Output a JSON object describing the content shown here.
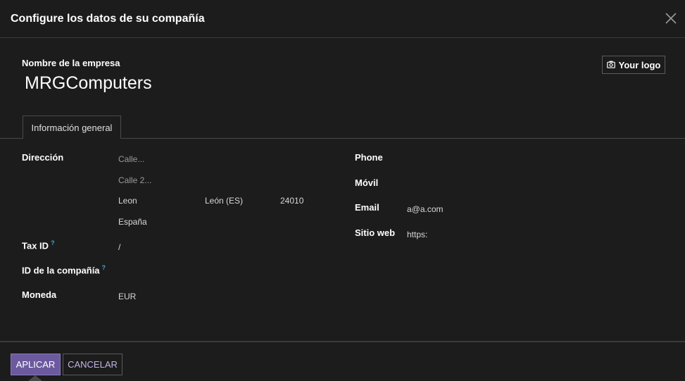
{
  "dialog": {
    "title": "Configure los datos de su compañía",
    "close_icon": "close-icon"
  },
  "company": {
    "name_label": "Nombre de la empresa",
    "name_value": "MRGComputers",
    "logo_button": "Your logo",
    "logo_icon": "camera-icon"
  },
  "tabs": [
    {
      "label": "Información general",
      "active": true
    }
  ],
  "fields_left": {
    "address_label": "Dirección",
    "street_placeholder": "Calle...",
    "street2_placeholder": "Calle 2...",
    "city": "Leon",
    "state": "León (ES)",
    "zip": "24010",
    "country": "España",
    "tax_id_label": "Tax ID",
    "tax_id_help": "?",
    "tax_id_value": "/",
    "company_id_label": "ID de la compañía",
    "company_id_help": "?",
    "company_id_value": "",
    "currency_label": "Moneda",
    "currency_value": "EUR"
  },
  "fields_right": {
    "phone_label": "Phone",
    "phone_value": "",
    "mobile_label": "Móvil",
    "mobile_value": "",
    "email_label": "Email",
    "email_value": "a@a.com",
    "website_label": "Sitio web",
    "website_value": "https:"
  },
  "footer": {
    "apply_label": "APLICAR",
    "cancel_label": "CANCELAR"
  },
  "colors": {
    "background": "#1c1c1c",
    "primary": "#6c5a9e",
    "help": "#3fa5c8"
  }
}
